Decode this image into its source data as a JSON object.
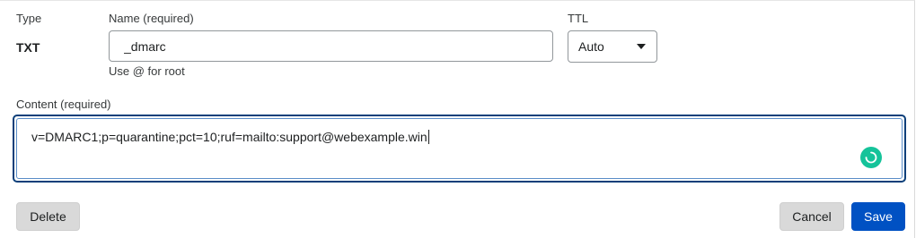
{
  "record": {
    "type_label": "Type",
    "type_value": "TXT",
    "name_label": "Name (required)",
    "name_value": "_dmarc",
    "name_hint": "Use @ for root",
    "ttl_label": "TTL",
    "ttl_value": "Auto",
    "content_label": "Content (required)",
    "content_value": "v=DMARC1;p=quarantine;pct=10;ruf=mailto:support@webexample.win"
  },
  "icons": {
    "ttl_dropdown": "caret-down-icon",
    "content_status": "grammar-assistant-loading-icon"
  },
  "colors": {
    "save_button": "#0051c3",
    "secondary_button": "#d9d9d9",
    "focus_border": "#0a3f7a",
    "assistant_badge": "#15c39a"
  },
  "actions": {
    "delete_label": "Delete",
    "cancel_label": "Cancel",
    "save_label": "Save"
  }
}
